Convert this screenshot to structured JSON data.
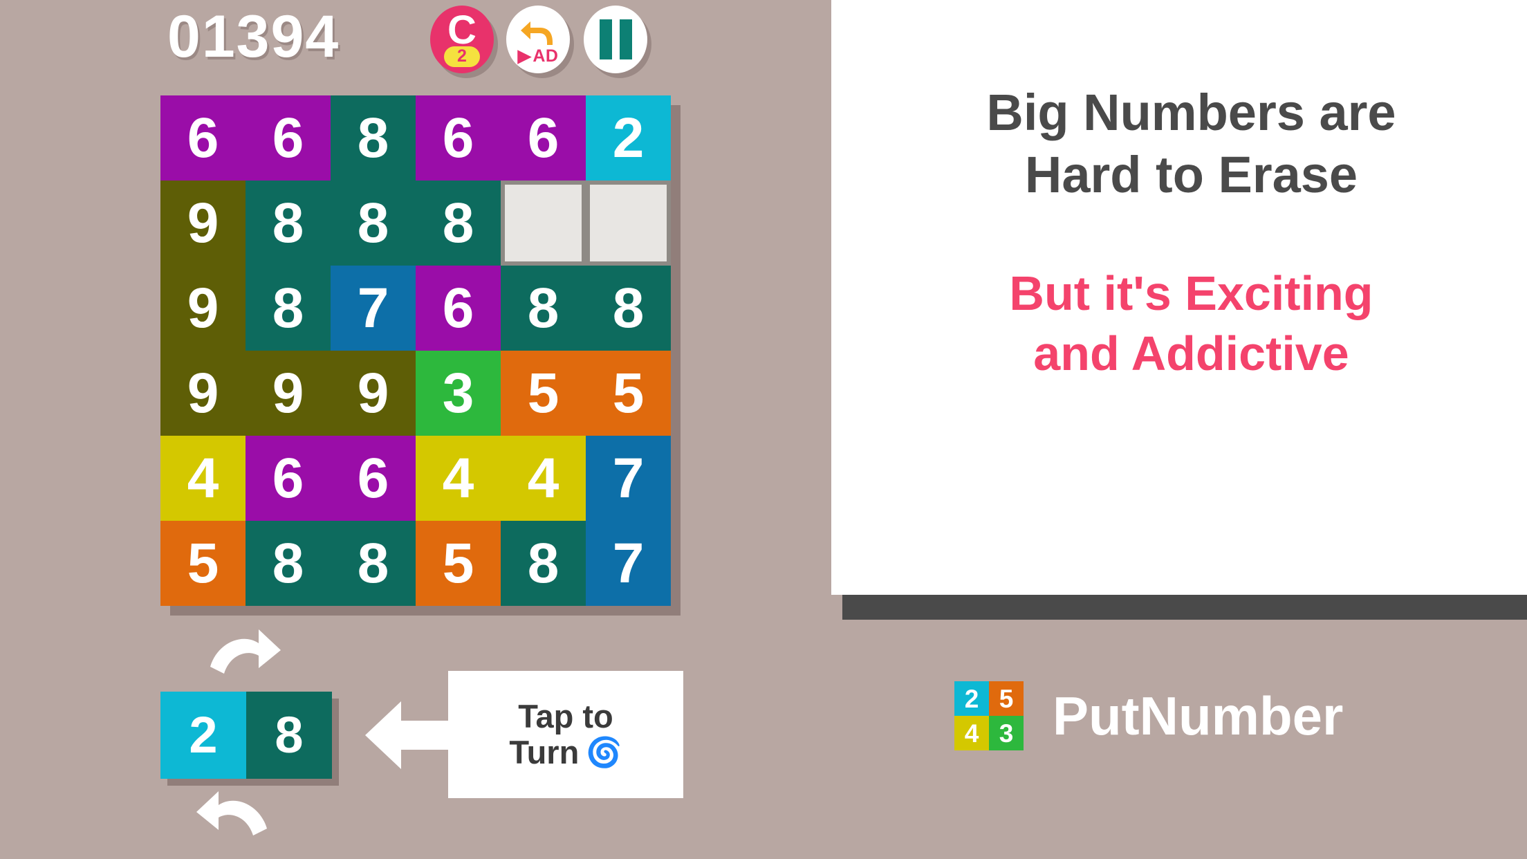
{
  "background_color": "#B8A7A2",
  "hud": {
    "score": "01394",
    "coin_button": {
      "letter": "C",
      "count": "2",
      "color": "#E8326B",
      "pill_color": "#F5E13F"
    },
    "undo_button": {
      "icon": "undo-arrow-icon",
      "label": "AD",
      "play_glyph": "▶",
      "arrow_color": "#F5A623",
      "label_color": "#E8326B"
    },
    "pause_button": {
      "icon": "pause-icon",
      "color": "#0D8074"
    }
  },
  "board": {
    "rows": 6,
    "cols": 6,
    "colors": {
      "purple": "#9A0DA8",
      "teal": "#0D6B5E",
      "cyan": "#0DB8D4",
      "olive": "#5E5E06",
      "blue": "#0D6FA8",
      "green": "#2DB83D",
      "orange": "#E06A0D",
      "yellow": "#D4C800",
      "empty": "#E8E6E3",
      "empty_border": "#8E8A85"
    },
    "cells": [
      [
        {
          "v": "6",
          "c": "purple"
        },
        {
          "v": "6",
          "c": "purple"
        },
        {
          "v": "8",
          "c": "teal"
        },
        {
          "v": "6",
          "c": "purple"
        },
        {
          "v": "6",
          "c": "purple"
        },
        {
          "v": "2",
          "c": "cyan"
        }
      ],
      [
        {
          "v": "9",
          "c": "olive"
        },
        {
          "v": "8",
          "c": "teal"
        },
        {
          "v": "8",
          "c": "teal"
        },
        {
          "v": "8",
          "c": "teal"
        },
        {
          "v": "",
          "c": "empty"
        },
        {
          "v": "",
          "c": "empty"
        }
      ],
      [
        {
          "v": "9",
          "c": "olive"
        },
        {
          "v": "8",
          "c": "teal"
        },
        {
          "v": "7",
          "c": "blue"
        },
        {
          "v": "6",
          "c": "purple"
        },
        {
          "v": "8",
          "c": "teal"
        },
        {
          "v": "8",
          "c": "teal"
        }
      ],
      [
        {
          "v": "9",
          "c": "olive"
        },
        {
          "v": "9",
          "c": "olive"
        },
        {
          "v": "9",
          "c": "olive"
        },
        {
          "v": "3",
          "c": "green"
        },
        {
          "v": "5",
          "c": "orange"
        },
        {
          "v": "5",
          "c": "orange"
        }
      ],
      [
        {
          "v": "4",
          "c": "yellow"
        },
        {
          "v": "6",
          "c": "purple"
        },
        {
          "v": "6",
          "c": "purple"
        },
        {
          "v": "4",
          "c": "yellow"
        },
        {
          "v": "4",
          "c": "yellow"
        },
        {
          "v": "7",
          "c": "blue"
        }
      ],
      [
        {
          "v": "5",
          "c": "orange"
        },
        {
          "v": "8",
          "c": "teal"
        },
        {
          "v": "8",
          "c": "teal"
        },
        {
          "v": "5",
          "c": "orange"
        },
        {
          "v": "8",
          "c": "teal"
        },
        {
          "v": "7",
          "c": "blue"
        }
      ]
    ]
  },
  "next_piece": {
    "tiles": [
      {
        "value": "2",
        "color": "#0DB8D4"
      },
      {
        "value": "8",
        "color": "#0D6B5E"
      }
    ],
    "rotate_icon_top": "rotate-clockwise-arrow-icon",
    "rotate_icon_bottom": "rotate-counterclockwise-arrow-icon"
  },
  "hint": {
    "line1": "Tap to",
    "line2": "Turn",
    "spiral": "🌀",
    "arrow_icon": "left-arrow-icon"
  },
  "promo": {
    "headline_line1": "Big Numbers are",
    "headline_line2": "Hard to Erase",
    "subline1": "But it's Exciting",
    "subline2": "and Addictive",
    "headline_color": "#4A4A4A",
    "subline_color": "#F4436C"
  },
  "brand": {
    "name": "PutNumber",
    "logo_tiles": [
      {
        "value": "2",
        "color": "#0DB8D4"
      },
      {
        "value": "5",
        "color": "#E06A0D"
      },
      {
        "value": "4",
        "color": "#D4C800"
      },
      {
        "value": "3",
        "color": "#2DB83D"
      }
    ]
  }
}
